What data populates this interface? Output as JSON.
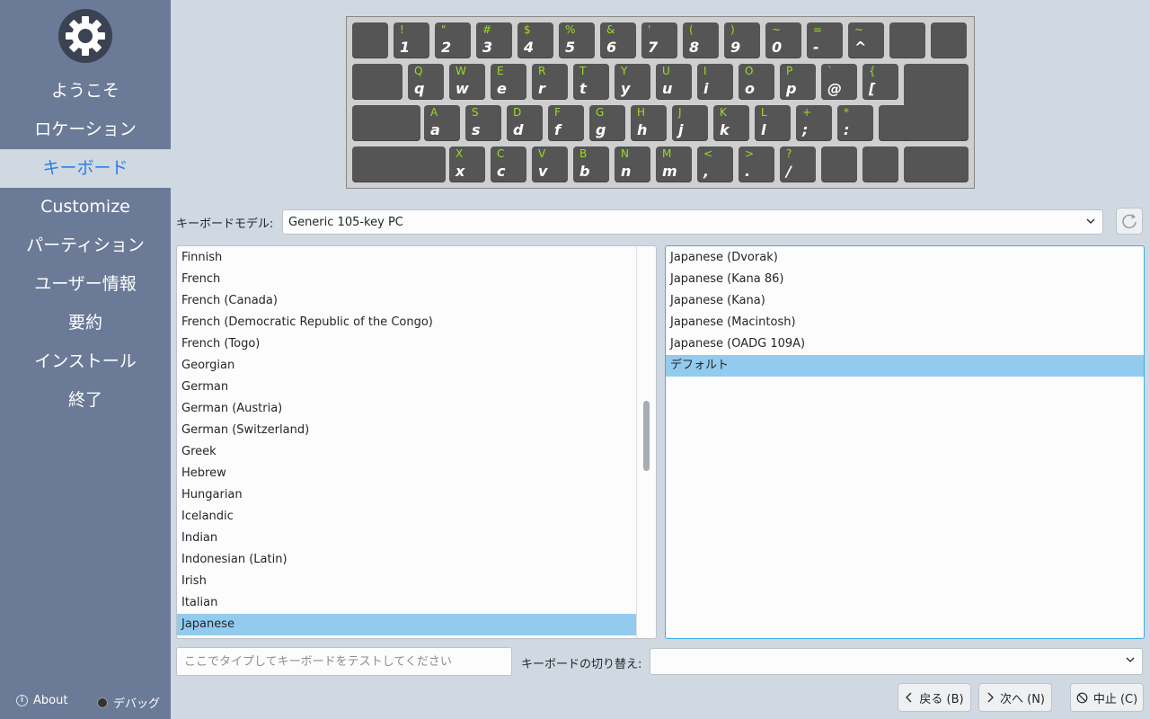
{
  "sidebar": {
    "items": [
      {
        "label": "ようこそ",
        "active": false
      },
      {
        "label": "ロケーション",
        "active": false
      },
      {
        "label": "キーボード",
        "active": true
      },
      {
        "label": "Customize",
        "active": false
      },
      {
        "label": "パーティション",
        "active": false
      },
      {
        "label": "ユーザー情報",
        "active": false
      },
      {
        "label": "要約",
        "active": false
      },
      {
        "label": "インストール",
        "active": false
      },
      {
        "label": "終了",
        "active": false
      }
    ],
    "about_label": "About",
    "debug_label": "デバッグ"
  },
  "keyboard_preview": {
    "rows": [
      [
        [
          "",
          ""
        ],
        [
          "!",
          "1"
        ],
        [
          "\"",
          "2"
        ],
        [
          "#",
          "3"
        ],
        [
          "$",
          "4"
        ],
        [
          "%",
          "5"
        ],
        [
          "&",
          "6"
        ],
        [
          "'",
          "7"
        ],
        [
          "(",
          "8"
        ],
        [
          ")",
          "9"
        ],
        [
          "~",
          "0"
        ],
        [
          "=",
          "-"
        ],
        [
          "~",
          "^"
        ],
        [
          "",
          ""
        ],
        [
          "",
          ""
        ]
      ],
      [
        [
          "",
          ""
        ],
        [
          "Q",
          "q"
        ],
        [
          "W",
          "w"
        ],
        [
          "E",
          "e"
        ],
        [
          "R",
          "r"
        ],
        [
          "T",
          "t"
        ],
        [
          "Y",
          "y"
        ],
        [
          "U",
          "u"
        ],
        [
          "I",
          "i"
        ],
        [
          "O",
          "o"
        ],
        [
          "P",
          "p"
        ],
        [
          "`",
          "@"
        ],
        [
          "{",
          "["
        ]
      ],
      [
        [
          "",
          ""
        ],
        [
          "A",
          "a"
        ],
        [
          "S",
          "s"
        ],
        [
          "D",
          "d"
        ],
        [
          "F",
          "f"
        ],
        [
          "G",
          "g"
        ],
        [
          "H",
          "h"
        ],
        [
          "J",
          "j"
        ],
        [
          "K",
          "k"
        ],
        [
          "L",
          "l"
        ],
        [
          "+",
          ";"
        ],
        [
          "*",
          ":"
        ],
        [
          "",
          ""
        ]
      ],
      [
        [
          "",
          ""
        ],
        [
          "X",
          "x"
        ],
        [
          "C",
          "c"
        ],
        [
          "V",
          "v"
        ],
        [
          "B",
          "b"
        ],
        [
          "N",
          "n"
        ],
        [
          "M",
          "m"
        ],
        [
          "<",
          ","
        ],
        [
          ">",
          "."
        ],
        [
          "?",
          "/"
        ],
        [
          "",
          ""
        ],
        [
          "",
          ""
        ],
        [
          "",
          ""
        ]
      ]
    ]
  },
  "model": {
    "label": "キーボードモデル:",
    "value": "Generic 105-key PC"
  },
  "layouts": {
    "items": [
      "Finnish",
      "French",
      "French (Canada)",
      "French (Democratic Republic of the Congo)",
      "French (Togo)",
      "Georgian",
      "German",
      "German (Austria)",
      "German (Switzerland)",
      "Greek",
      "Hebrew",
      "Hungarian",
      "Icelandic",
      "Indian",
      "Indonesian (Latin)",
      "Irish",
      "Italian",
      "Japanese"
    ],
    "selected": "Japanese"
  },
  "variants": {
    "items": [
      "Japanese (Dvorak)",
      "Japanese (Kana 86)",
      "Japanese (Kana)",
      "Japanese (Macintosh)",
      "Japanese (OADG 109A)",
      "デフォルト"
    ],
    "selected": "デフォルト"
  },
  "test": {
    "placeholder": "ここでタイプしてキーボードをテストしてください"
  },
  "switch": {
    "label": "キーボードの切り替え:",
    "value": ""
  },
  "buttons": {
    "back": "戻る (B)",
    "next": "次へ (N)",
    "cancel": "中止 (C)"
  }
}
